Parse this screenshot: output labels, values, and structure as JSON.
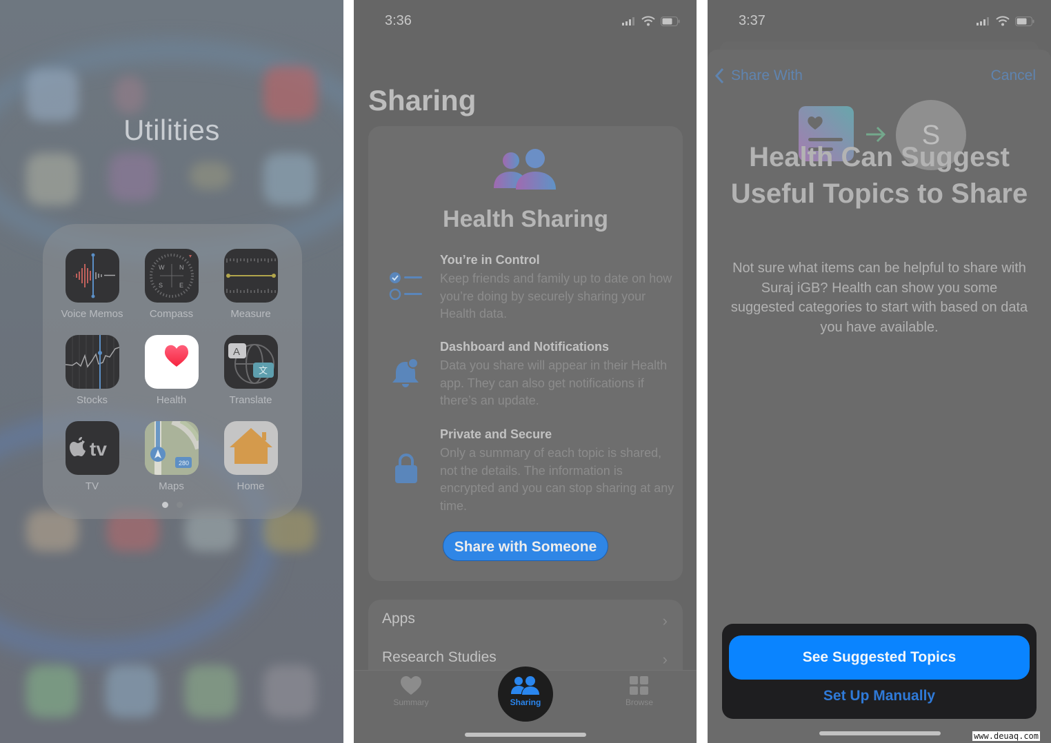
{
  "panel1": {
    "folder_title": "Utilities",
    "apps": [
      {
        "label": "Voice Memos",
        "icon": "voice-memos-icon"
      },
      {
        "label": "Compass",
        "icon": "compass-icon"
      },
      {
        "label": "Measure",
        "icon": "measure-icon"
      },
      {
        "label": "Stocks",
        "icon": "stocks-icon"
      },
      {
        "label": "Health",
        "icon": "health-heart-icon"
      },
      {
        "label": "Translate",
        "icon": "translate-icon"
      },
      {
        "label": "TV",
        "icon": "apple-tv-icon"
      },
      {
        "label": "Maps",
        "icon": "maps-icon"
      },
      {
        "label": "Home",
        "icon": "home-icon"
      }
    ],
    "page_dots": {
      "total": 2,
      "current": 1
    },
    "compass_letters": [
      "W",
      "N",
      "S",
      "E"
    ],
    "tv_text": "tv",
    "translate_glyphs": {
      "latin": "A",
      "cjk": "文"
    },
    "maps_shield": "280"
  },
  "panel2": {
    "status_time": "3:36",
    "title": "Sharing",
    "card_title": "Health Sharing",
    "features": [
      {
        "title": "You’re in Control",
        "body": "Keep friends and family up to date on how you’re doing by securely sharing your Health data.",
        "icon": "checklist-icon"
      },
      {
        "title": "Dashboard and Notifications",
        "body": "Data you share will appear in their Health app. They can also get notifications if there’s an update.",
        "icon": "bell-badge-icon"
      },
      {
        "title": "Private and Secure",
        "body": "Only a summary of each topic is shared, not the details. The information is encrypted and you can stop sharing at any time.",
        "icon": "lock-icon"
      }
    ],
    "share_button": "Share with Someone",
    "list_items": [
      {
        "label": "Apps"
      },
      {
        "label": "Research Studies"
      }
    ],
    "tabs": [
      {
        "label": "Summary",
        "icon": "heart-icon",
        "active": false
      },
      {
        "label": "Sharing",
        "icon": "people-icon",
        "active": true
      },
      {
        "label": "Browse",
        "icon": "grid-icon",
        "active": false
      }
    ],
    "colors": {
      "accent": "#0a84ff",
      "background": "#666666"
    }
  },
  "panel3": {
    "status_time": "3:37",
    "nav_back": "Share With",
    "nav_cancel": "Cancel",
    "avatar_initial": "S",
    "title": "Health Can Suggest Useful Topics to Share",
    "body": "Not sure what items can be helpful to share with Suraj iGB? Health can show you some suggested categories to start with based on data you have available.",
    "primary_button": "See Suggested Topics",
    "secondary_button": "Set Up Manually",
    "watermark": "www.deuaq.com",
    "colors": {
      "primary": "#0a84ff",
      "secondary_text": "#2f7ad8",
      "action_sheet_bg": "#1e1e20"
    }
  }
}
